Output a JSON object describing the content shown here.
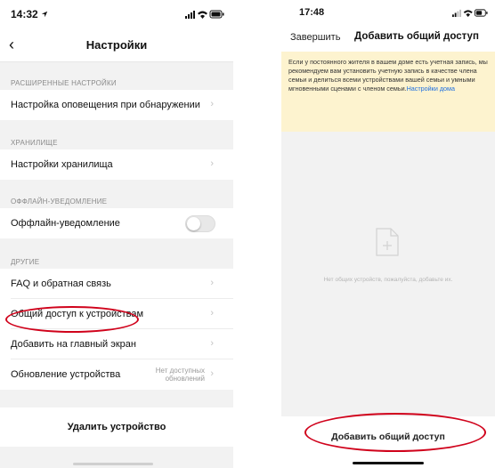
{
  "left_screen": {
    "status": {
      "time": "14:32",
      "location_icon": "location-arrow-icon"
    },
    "nav": {
      "back_icon": "chevron-left-icon",
      "title": "Настройки"
    },
    "sections": {
      "advanced": {
        "header": "РАСШИРЕННЫЕ НАСТРОЙКИ",
        "item": "Настройка оповещения при обнаружении"
      },
      "storage": {
        "header": "ХРАНИЛИЩЕ",
        "item": "Настройки хранилища"
      },
      "offline": {
        "header": "ОФФЛАЙН-УВЕДОМЛЕНИЕ",
        "item": "Оффлайн-уведомление",
        "toggle_on": false
      },
      "other": {
        "header": "ДРУГИЕ",
        "items": [
          "FAQ и обратная связь",
          "Общий доступ к устройствам",
          "Добавить на главный экран",
          "Обновление устройства"
        ],
        "update_value": "Нет доступных обновлений"
      }
    },
    "delete_button": "Удалить устройство"
  },
  "right_screen": {
    "status": {
      "time": "17:48"
    },
    "nav": {
      "done": "Завершить",
      "title": "Добавить общий доступ"
    },
    "notice": {
      "text": "Если у постоянного жителя в вашем доме есть учетная запись, мы рекомендуем вам установить учетную запись в качестве члена семьи и делиться всеми устройствами вашей семьи и умными мгновенными сценами с членом семьи.",
      "link": "Настройки дома"
    },
    "empty_state": {
      "icon": "add-file-icon",
      "text": "Нет общих устройств, пожалуйста, добавьте их."
    },
    "add_button": "Добавить общий доступ"
  },
  "colors": {
    "annotation": "#d0021b",
    "link": "#1e6fe0",
    "notice_bg": "#fdf3cf"
  }
}
